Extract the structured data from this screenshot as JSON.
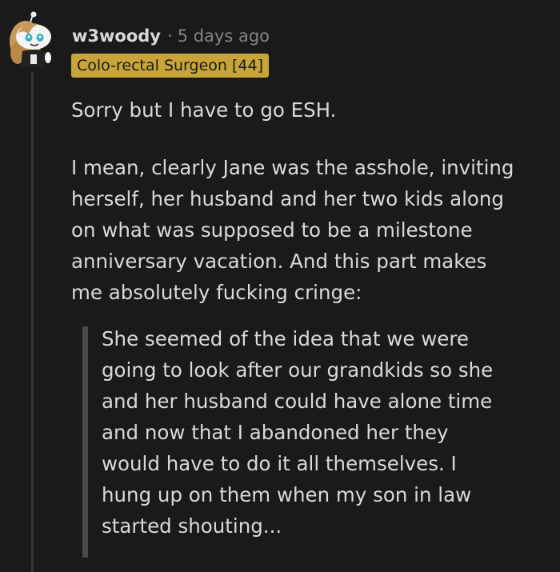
{
  "comment": {
    "author": "w3woody",
    "separator": "·",
    "timestamp": "5 days ago",
    "flair": "Colo-rectal Surgeon [44]",
    "paragraph_1": "Sorry but I have to go ESH.",
    "paragraph_2_lines": [
      "I mean, clearly Jane was the asshole, inviting",
      "herself, her husband and her two kids along",
      "on what was supposed to be a milestone",
      "anniversary vacation. And this part makes",
      "me absolutely fucking cringe:"
    ],
    "quote_lines": [
      "She seemed of the idea that we were",
      "going to look after our grandkids so she",
      "and her husband could have alone time",
      "and now that I abandoned her they",
      "would have to do it all themselves. I",
      "hung up on them when my son in law",
      "started shouting..."
    ]
  },
  "colors": {
    "background": "#1a1a1b",
    "text": "#d7dadc",
    "meta": "#818384",
    "flair_bg": "#c8a538",
    "flair_text": "#1a1a1b",
    "thread_line": "#343536",
    "quote_bar": "#4a4a4c"
  },
  "icons": {
    "avatar": "snoo-avatar-icon"
  }
}
